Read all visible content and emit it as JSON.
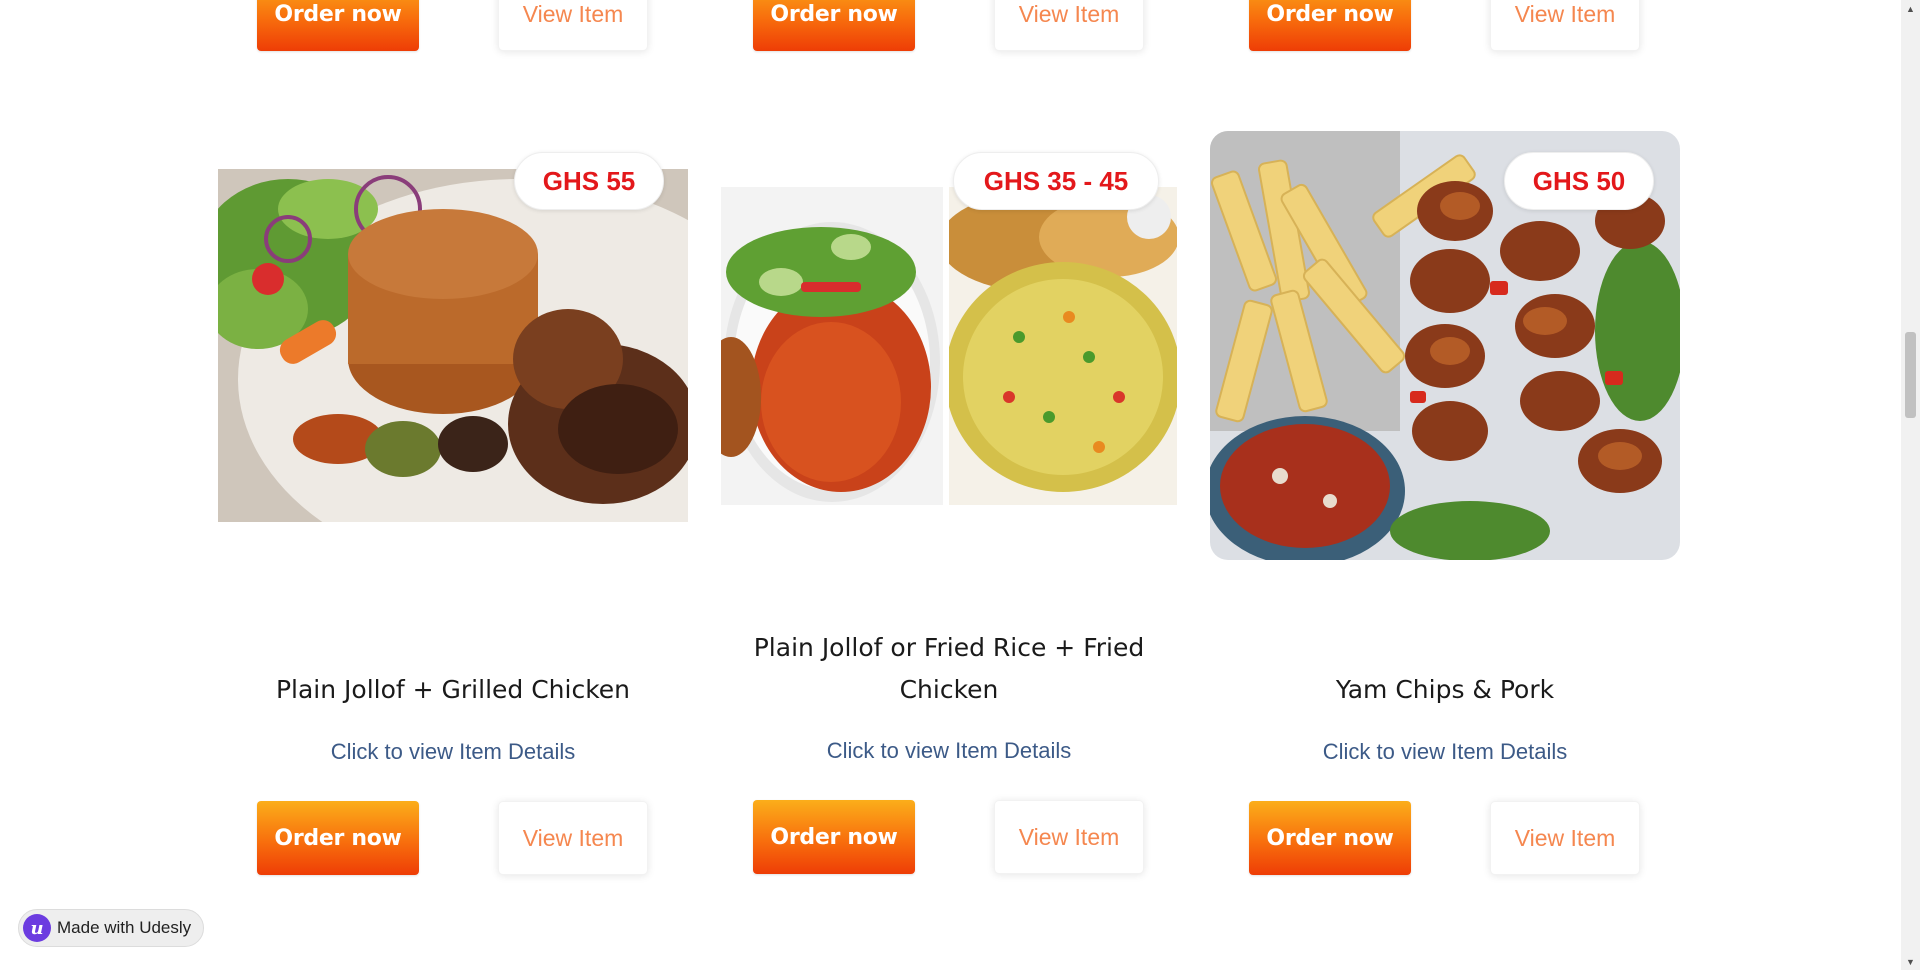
{
  "colors": {
    "price": "#e3181b",
    "order_button_gradient": [
      "#fbae1a",
      "#f86f0d",
      "#ee3d06"
    ],
    "view_button_text": "#f5874f",
    "details_link": "#3c5a87",
    "badge_logo": "#6c3ce0"
  },
  "top_row": {
    "cards": [
      {
        "order_label": "Order now",
        "view_label": "View Item"
      },
      {
        "order_label": "Order now",
        "view_label": "View Item"
      },
      {
        "order_label": "Order now",
        "view_label": "View Item"
      }
    ]
  },
  "items": [
    {
      "price": "GHS 55",
      "title": "Plain Jollof + Grilled Chicken",
      "details_link": "Click to view Item Details",
      "order_label": "Order now",
      "view_label": "View Item",
      "image_icon": "jollof-chicken-image"
    },
    {
      "price": "GHS 35 - 45",
      "title": "Plain Jollof or Fried Rice + Fried Chicken",
      "details_link": "Click to view Item Details",
      "order_label": "Order now",
      "view_label": "View Item",
      "image_icon": "jollof-fried-rice-image"
    },
    {
      "price": "GHS 50",
      "title": "Yam Chips & Pork",
      "details_link": "Click to view Item Details",
      "order_label": "Order now",
      "view_label": "View Item",
      "image_icon": "yam-chips-pork-image"
    }
  ],
  "badge": {
    "logo_letter": "u",
    "text": "Made with Udesly"
  },
  "scrollbar": {
    "up_arrow": "▲",
    "down_arrow": "▼"
  }
}
